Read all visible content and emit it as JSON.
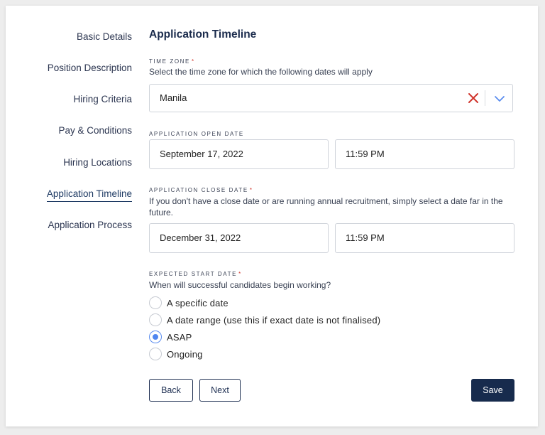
{
  "nav": {
    "items": [
      {
        "label": "Basic Details"
      },
      {
        "label": "Position Description"
      },
      {
        "label": "Hiring Criteria"
      },
      {
        "label": "Pay & Conditions"
      },
      {
        "label": "Hiring Locations"
      },
      {
        "label": "Application Timeline"
      },
      {
        "label": "Application Process"
      }
    ],
    "active_index": 5
  },
  "form": {
    "title": "Application Timeline",
    "time_zone": {
      "label": "TIME ZONE",
      "required_mark": "*",
      "help": "Select the time zone for which the following dates will apply",
      "value": "Manila"
    },
    "open_date": {
      "label": "APPLICATION OPEN DATE",
      "date": "September 17, 2022",
      "time": "11:59 PM"
    },
    "close_date": {
      "label": "APPLICATION CLOSE DATE",
      "required_mark": "*",
      "help": "If you don't have a close date or are running annual recruitment, simply select a date far in the future.",
      "date": "December 31, 2022",
      "time": "11:59 PM"
    },
    "start_date": {
      "label": "EXPECTED START DATE",
      "required_mark": "*",
      "help": "When will successful candidates begin working?",
      "options": [
        {
          "label": "A specific date",
          "checked": false
        },
        {
          "label": "A date range (use this if exact date is not finalised)",
          "checked": false
        },
        {
          "label": "ASAP",
          "checked": true
        },
        {
          "label": "Ongoing",
          "checked": false
        }
      ]
    }
  },
  "buttons": {
    "back": "Back",
    "next": "Next",
    "save": "Save"
  },
  "colors": {
    "primary": "#172b4d",
    "accent": "#4f86f0",
    "required": "#d0342c"
  }
}
